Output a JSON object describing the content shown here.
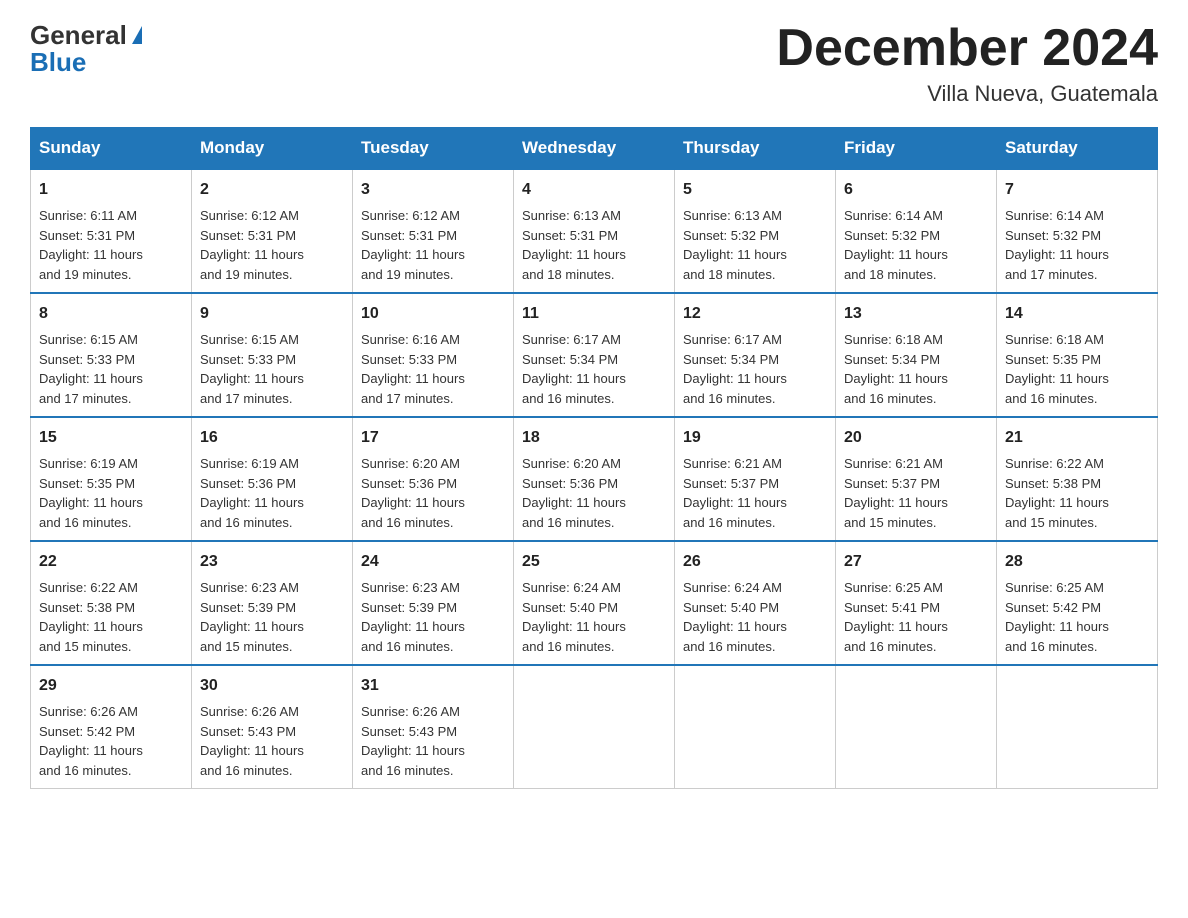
{
  "header": {
    "logo_general": "General",
    "logo_blue": "Blue",
    "month_title": "December 2024",
    "location": "Villa Nueva, Guatemala"
  },
  "days_of_week": [
    "Sunday",
    "Monday",
    "Tuesday",
    "Wednesday",
    "Thursday",
    "Friday",
    "Saturday"
  ],
  "weeks": [
    [
      {
        "day": "1",
        "sunrise": "6:11 AM",
        "sunset": "5:31 PM",
        "daylight": "11 hours and 19 minutes."
      },
      {
        "day": "2",
        "sunrise": "6:12 AM",
        "sunset": "5:31 PM",
        "daylight": "11 hours and 19 minutes."
      },
      {
        "day": "3",
        "sunrise": "6:12 AM",
        "sunset": "5:31 PM",
        "daylight": "11 hours and 19 minutes."
      },
      {
        "day": "4",
        "sunrise": "6:13 AM",
        "sunset": "5:31 PM",
        "daylight": "11 hours and 18 minutes."
      },
      {
        "day": "5",
        "sunrise": "6:13 AM",
        "sunset": "5:32 PM",
        "daylight": "11 hours and 18 minutes."
      },
      {
        "day": "6",
        "sunrise": "6:14 AM",
        "sunset": "5:32 PM",
        "daylight": "11 hours and 18 minutes."
      },
      {
        "day": "7",
        "sunrise": "6:14 AM",
        "sunset": "5:32 PM",
        "daylight": "11 hours and 17 minutes."
      }
    ],
    [
      {
        "day": "8",
        "sunrise": "6:15 AM",
        "sunset": "5:33 PM",
        "daylight": "11 hours and 17 minutes."
      },
      {
        "day": "9",
        "sunrise": "6:15 AM",
        "sunset": "5:33 PM",
        "daylight": "11 hours and 17 minutes."
      },
      {
        "day": "10",
        "sunrise": "6:16 AM",
        "sunset": "5:33 PM",
        "daylight": "11 hours and 17 minutes."
      },
      {
        "day": "11",
        "sunrise": "6:17 AM",
        "sunset": "5:34 PM",
        "daylight": "11 hours and 16 minutes."
      },
      {
        "day": "12",
        "sunrise": "6:17 AM",
        "sunset": "5:34 PM",
        "daylight": "11 hours and 16 minutes."
      },
      {
        "day": "13",
        "sunrise": "6:18 AM",
        "sunset": "5:34 PM",
        "daylight": "11 hours and 16 minutes."
      },
      {
        "day": "14",
        "sunrise": "6:18 AM",
        "sunset": "5:35 PM",
        "daylight": "11 hours and 16 minutes."
      }
    ],
    [
      {
        "day": "15",
        "sunrise": "6:19 AM",
        "sunset": "5:35 PM",
        "daylight": "11 hours and 16 minutes."
      },
      {
        "day": "16",
        "sunrise": "6:19 AM",
        "sunset": "5:36 PM",
        "daylight": "11 hours and 16 minutes."
      },
      {
        "day": "17",
        "sunrise": "6:20 AM",
        "sunset": "5:36 PM",
        "daylight": "11 hours and 16 minutes."
      },
      {
        "day": "18",
        "sunrise": "6:20 AM",
        "sunset": "5:36 PM",
        "daylight": "11 hours and 16 minutes."
      },
      {
        "day": "19",
        "sunrise": "6:21 AM",
        "sunset": "5:37 PM",
        "daylight": "11 hours and 16 minutes."
      },
      {
        "day": "20",
        "sunrise": "6:21 AM",
        "sunset": "5:37 PM",
        "daylight": "11 hours and 15 minutes."
      },
      {
        "day": "21",
        "sunrise": "6:22 AM",
        "sunset": "5:38 PM",
        "daylight": "11 hours and 15 minutes."
      }
    ],
    [
      {
        "day": "22",
        "sunrise": "6:22 AM",
        "sunset": "5:38 PM",
        "daylight": "11 hours and 15 minutes."
      },
      {
        "day": "23",
        "sunrise": "6:23 AM",
        "sunset": "5:39 PM",
        "daylight": "11 hours and 15 minutes."
      },
      {
        "day": "24",
        "sunrise": "6:23 AM",
        "sunset": "5:39 PM",
        "daylight": "11 hours and 16 minutes."
      },
      {
        "day": "25",
        "sunrise": "6:24 AM",
        "sunset": "5:40 PM",
        "daylight": "11 hours and 16 minutes."
      },
      {
        "day": "26",
        "sunrise": "6:24 AM",
        "sunset": "5:40 PM",
        "daylight": "11 hours and 16 minutes."
      },
      {
        "day": "27",
        "sunrise": "6:25 AM",
        "sunset": "5:41 PM",
        "daylight": "11 hours and 16 minutes."
      },
      {
        "day": "28",
        "sunrise": "6:25 AM",
        "sunset": "5:42 PM",
        "daylight": "11 hours and 16 minutes."
      }
    ],
    [
      {
        "day": "29",
        "sunrise": "6:26 AM",
        "sunset": "5:42 PM",
        "daylight": "11 hours and 16 minutes."
      },
      {
        "day": "30",
        "sunrise": "6:26 AM",
        "sunset": "5:43 PM",
        "daylight": "11 hours and 16 minutes."
      },
      {
        "day": "31",
        "sunrise": "6:26 AM",
        "sunset": "5:43 PM",
        "daylight": "11 hours and 16 minutes."
      },
      null,
      null,
      null,
      null
    ]
  ],
  "labels": {
    "sunrise": "Sunrise:",
    "sunset": "Sunset:",
    "daylight": "Daylight:"
  }
}
